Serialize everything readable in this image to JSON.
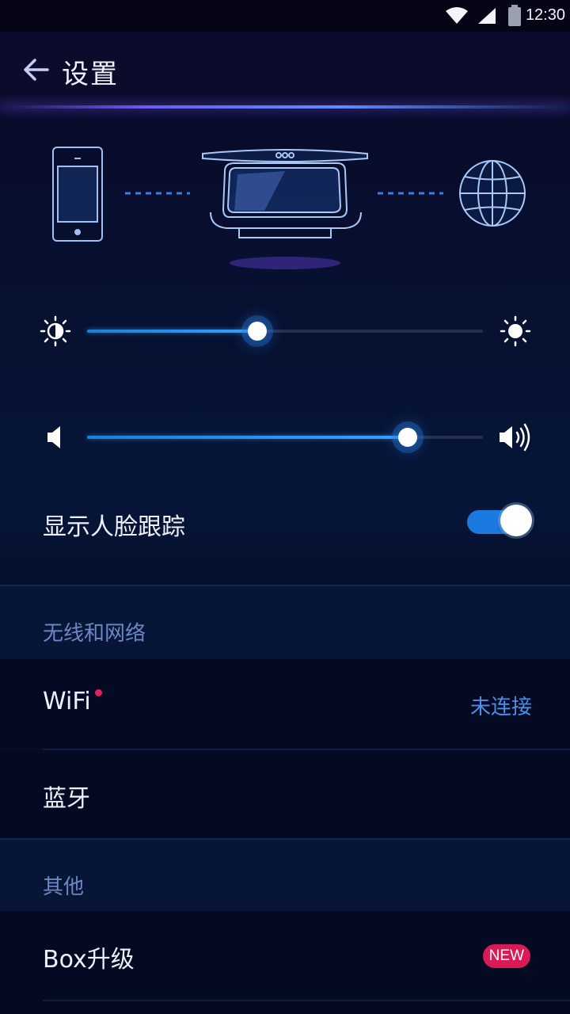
{
  "status_bar": {
    "time": "12:30",
    "icons": [
      "wifi-icon",
      "cell-signal-icon",
      "battery-icon"
    ]
  },
  "header": {
    "title": "设置",
    "back_icon": "arrow-left-icon"
  },
  "illustration": {
    "icons": [
      "phone-icon",
      "box-device-icon",
      "globe-icon"
    ]
  },
  "brightness": {
    "value_percent": 43,
    "min_icon": "brightness-low-icon",
    "max_icon": "brightness-high-icon"
  },
  "volume": {
    "value_percent": 81,
    "min_icon": "volume-low-icon",
    "max_icon": "volume-high-icon"
  },
  "face_tracking": {
    "label": "显示人脸跟踪",
    "enabled": true
  },
  "sections": {
    "network": {
      "title": "无线和网络",
      "wifi": {
        "label": "WiFi",
        "status": "未连接",
        "has_dot": true
      },
      "bluetooth": {
        "label": "蓝牙"
      }
    },
    "other": {
      "title": "其他",
      "box_upgrade": {
        "label": "Box升级",
        "badge": "NEW"
      }
    }
  },
  "colors": {
    "accent": "#1a7ae0",
    "badge": "#d91a56",
    "link": "#4c8ee8"
  }
}
